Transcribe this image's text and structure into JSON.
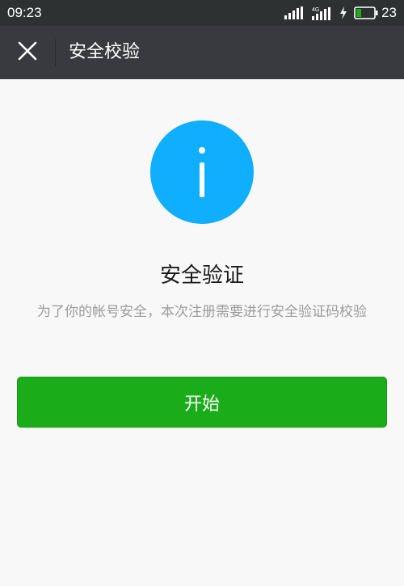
{
  "status_bar": {
    "time": "09:23",
    "battery_level": "23",
    "network_label": "4G",
    "icons": [
      "signal-icon",
      "signal-4g-icon",
      "charging-icon",
      "battery-icon"
    ]
  },
  "nav": {
    "title": "安全校验",
    "close_icon": "close-icon"
  },
  "main": {
    "icon": "info-icon",
    "heading": "安全验证",
    "description": "为了你的帐号安全，本次注册需要进行安全验证码校验",
    "start_button_label": "开始"
  },
  "colors": {
    "status_bar_bg": "#2e3132",
    "nav_bg": "#393a3f",
    "page_bg": "#f8f8f8",
    "info_icon": "#10aeff",
    "primary_button": "#1aad19",
    "battery_fill": "#1aad19"
  }
}
